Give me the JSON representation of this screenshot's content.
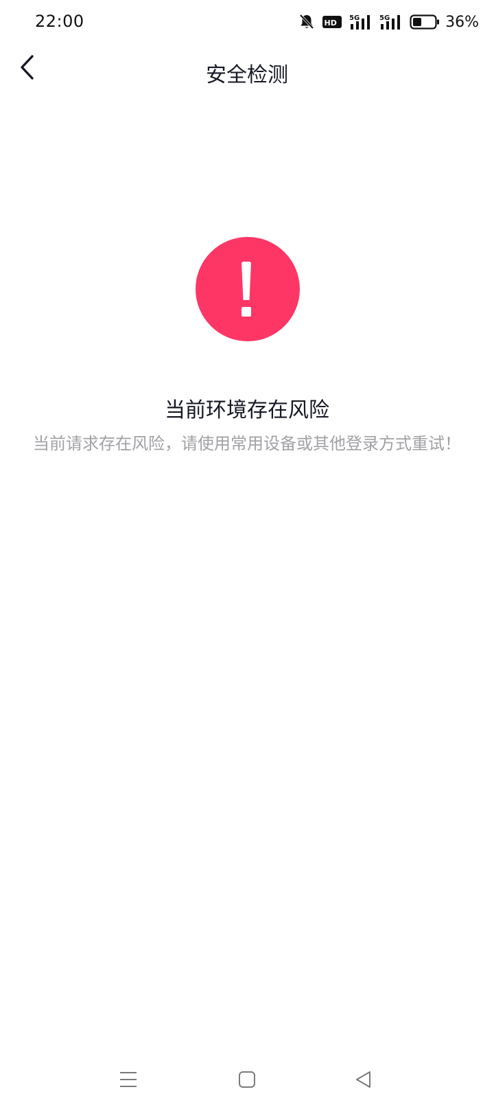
{
  "status_bar": {
    "time": "22:00",
    "icons": [
      "bell-off-icon",
      "hd-icon",
      "signal-5g-icon",
      "signal-5g-icon",
      "battery-icon"
    ],
    "battery_percent": "36%",
    "network_a": "5G",
    "network_b": "5G",
    "hd_label": "HD"
  },
  "nav": {
    "title": "安全检测",
    "back_icon": "chevron-left-icon"
  },
  "warning": {
    "icon": "exclamation-circle-icon",
    "color": "#fe3666",
    "title": "当前环境存在风险",
    "description": "当前请求存在风险，请使用常用设备或其他登录方式重试！"
  },
  "system_nav": {
    "icons": [
      "menu-icon",
      "home-icon",
      "back-triangle-icon"
    ]
  }
}
